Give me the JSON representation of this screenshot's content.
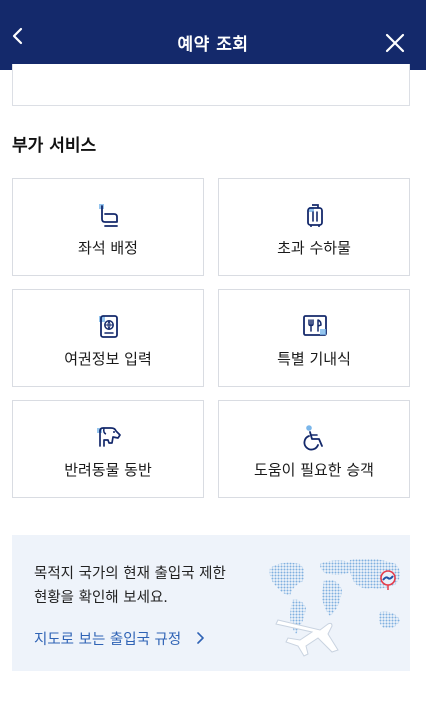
{
  "header": {
    "title": "예약 조회",
    "back_icon": "chevron-left-icon",
    "close_icon": "close-icon",
    "bg_color": "#14296b"
  },
  "section": {
    "title": "부가 서비스"
  },
  "services": [
    {
      "label": "좌석 배정",
      "icon": "seat-icon"
    },
    {
      "label": "초과 수하물",
      "icon": "luggage-icon"
    },
    {
      "label": "여권정보 입력",
      "icon": "passport-icon"
    },
    {
      "label": "특별 기내식",
      "icon": "meal-icon"
    },
    {
      "label": "반려동물 동반",
      "icon": "dog-icon"
    },
    {
      "label": "도움이 필요한 승객",
      "icon": "wheelchair-icon"
    }
  ],
  "banner": {
    "line1": "목적지 국가의 현재 출입국 제한",
    "line2": "현황을 확인해 보세요.",
    "link": "지도로 보는 출입국 규정",
    "accent_color": "#2f63b5"
  }
}
